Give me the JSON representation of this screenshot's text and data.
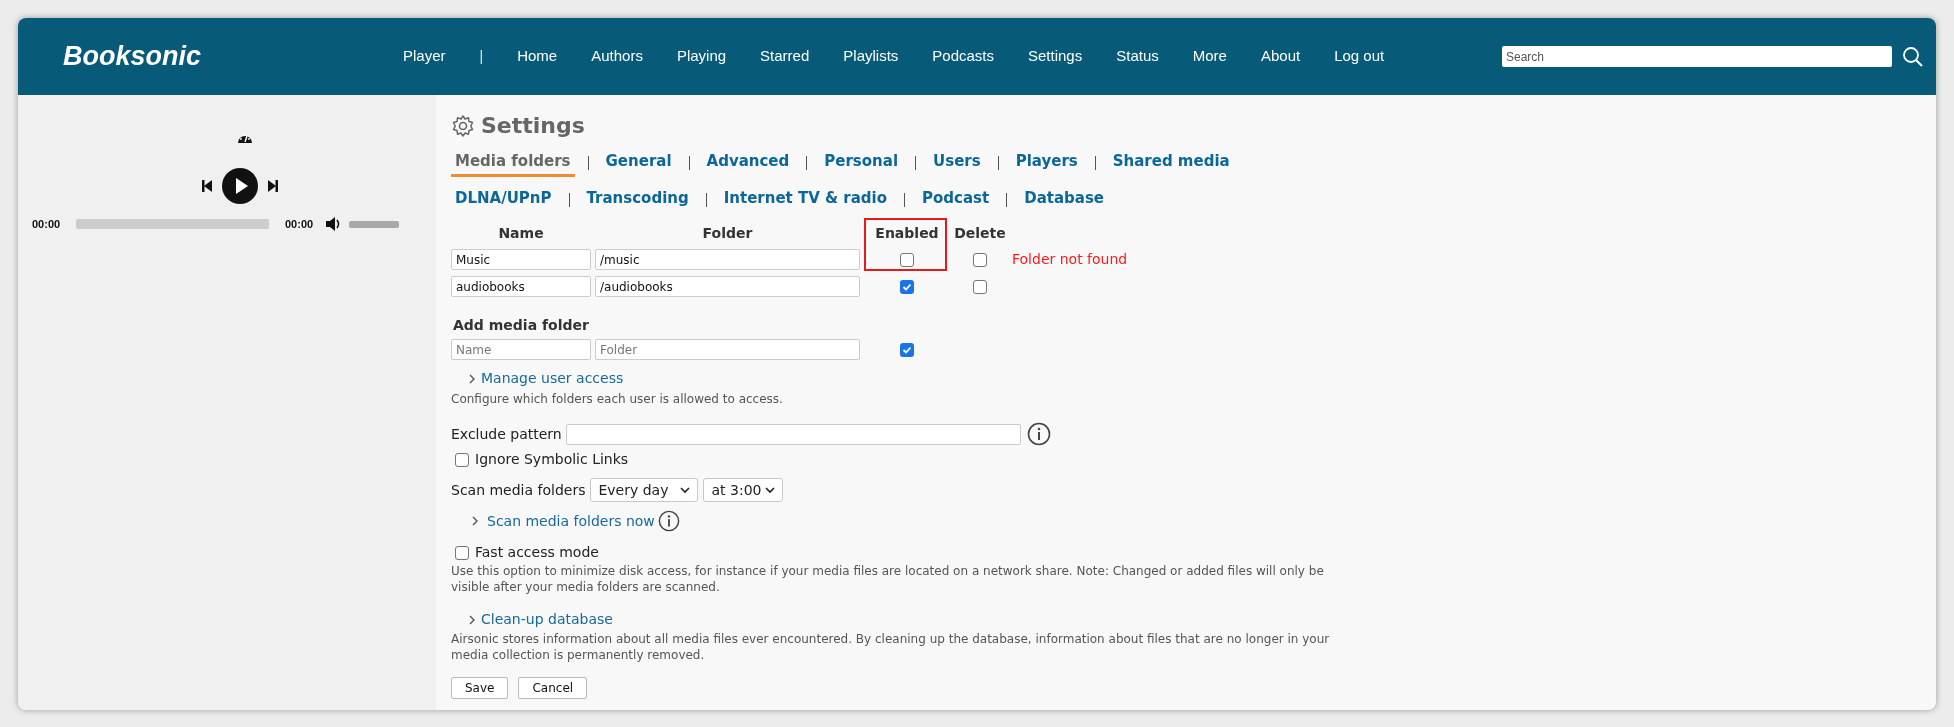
{
  "logo": "Booksonic",
  "nav": [
    {
      "label": "Player",
      "kind": "link"
    },
    {
      "label": "|",
      "kind": "separator"
    },
    {
      "label": "Home",
      "kind": "link"
    },
    {
      "label": "Authors",
      "kind": "link"
    },
    {
      "label": "Playing",
      "kind": "link"
    },
    {
      "label": "Starred",
      "kind": "link"
    },
    {
      "label": "Playlists",
      "kind": "link"
    },
    {
      "label": "Podcasts",
      "kind": "link"
    },
    {
      "label": "Settings",
      "kind": "link"
    },
    {
      "label": "Status",
      "kind": "link"
    },
    {
      "label": "More",
      "kind": "link"
    },
    {
      "label": "About",
      "kind": "link"
    },
    {
      "label": "Log out",
      "kind": "link"
    }
  ],
  "search": {
    "placeholder": "Search"
  },
  "player": {
    "elapsed": "00:00",
    "duration": "00:00",
    "progress": {
      "level": 0
    },
    "volume": {
      "level": 1
    }
  },
  "page_title": "Settings",
  "tabs": [
    [
      {
        "label": "Media folders",
        "selected": true
      },
      {
        "label": "General",
        "selected": false
      },
      {
        "label": "Advanced",
        "selected": false
      },
      {
        "label": "Personal",
        "selected": false
      },
      {
        "label": "Users",
        "selected": false
      },
      {
        "label": "Players",
        "selected": false
      },
      {
        "label": "Shared media",
        "selected": false
      }
    ],
    [
      {
        "label": "DLNA/UPnP",
        "selected": false
      },
      {
        "label": "Transcoding",
        "selected": false
      },
      {
        "label": "Internet TV & radio",
        "selected": false
      },
      {
        "label": "Podcast",
        "selected": false
      },
      {
        "label": "Database",
        "selected": false
      }
    ]
  ],
  "table": {
    "columns": [
      {
        "label": "Name",
        "highlighted": false
      },
      {
        "label": "Folder",
        "highlighted": false
      },
      {
        "label": "Enabled",
        "highlighted": true
      },
      {
        "label": "Delete",
        "highlighted": false
      }
    ],
    "rows": [
      {
        "name": "Music",
        "folder": "/music",
        "enabled": false,
        "delete": false,
        "message": "Folder not found"
      },
      {
        "name": "audiobooks",
        "folder": "/audiobooks",
        "enabled": true,
        "delete": false
      }
    ]
  },
  "add_folder": {
    "title": "Add media folder",
    "name_placeholder": "Name",
    "folder_placeholder": "Folder",
    "enabled": true
  },
  "manage_access": {
    "link": "Manage user access",
    "description": "Configure which folders each user is allowed to access."
  },
  "exclude": {
    "label": "Exclude pattern"
  },
  "ignore_symlinks": {
    "label": "Ignore Symbolic Links",
    "checked": false
  },
  "scan": {
    "label": "Scan media folders",
    "interval": "Every day",
    "time": "at 3:00",
    "now_link": "Scan media folders now"
  },
  "fast_access": {
    "label": "Fast access mode",
    "checked": false,
    "description": "Use this option to minimize disk access, for instance if your media files are located on a network share. Note: Changed or added files will only be visible after your media folders are scanned."
  },
  "cleanup": {
    "link": "Clean-up database",
    "description": "Airsonic stores information about all media files ever encountered. By cleaning up the database, information about files that are no longer in your media collection is permanently removed."
  },
  "buttons": [
    "Save",
    "Cancel"
  ]
}
